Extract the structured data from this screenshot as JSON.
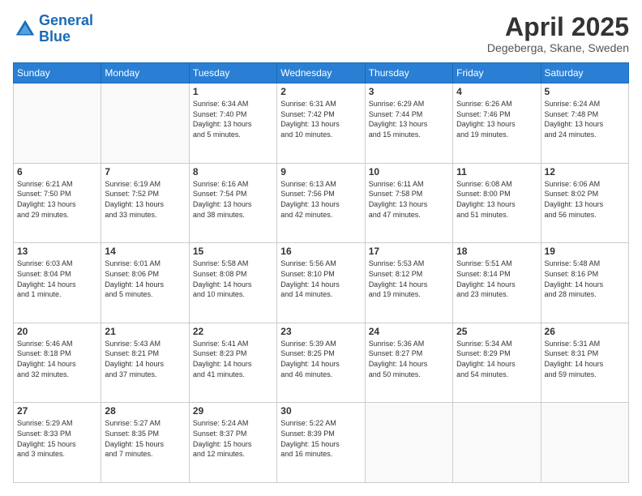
{
  "header": {
    "logo_line1": "General",
    "logo_line2": "Blue",
    "month_title": "April 2025",
    "location": "Degeberga, Skane, Sweden"
  },
  "weekdays": [
    "Sunday",
    "Monday",
    "Tuesday",
    "Wednesday",
    "Thursday",
    "Friday",
    "Saturday"
  ],
  "weeks": [
    [
      {
        "day": "",
        "info": ""
      },
      {
        "day": "",
        "info": ""
      },
      {
        "day": "1",
        "info": "Sunrise: 6:34 AM\nSunset: 7:40 PM\nDaylight: 13 hours\nand 5 minutes."
      },
      {
        "day": "2",
        "info": "Sunrise: 6:31 AM\nSunset: 7:42 PM\nDaylight: 13 hours\nand 10 minutes."
      },
      {
        "day": "3",
        "info": "Sunrise: 6:29 AM\nSunset: 7:44 PM\nDaylight: 13 hours\nand 15 minutes."
      },
      {
        "day": "4",
        "info": "Sunrise: 6:26 AM\nSunset: 7:46 PM\nDaylight: 13 hours\nand 19 minutes."
      },
      {
        "day": "5",
        "info": "Sunrise: 6:24 AM\nSunset: 7:48 PM\nDaylight: 13 hours\nand 24 minutes."
      }
    ],
    [
      {
        "day": "6",
        "info": "Sunrise: 6:21 AM\nSunset: 7:50 PM\nDaylight: 13 hours\nand 29 minutes."
      },
      {
        "day": "7",
        "info": "Sunrise: 6:19 AM\nSunset: 7:52 PM\nDaylight: 13 hours\nand 33 minutes."
      },
      {
        "day": "8",
        "info": "Sunrise: 6:16 AM\nSunset: 7:54 PM\nDaylight: 13 hours\nand 38 minutes."
      },
      {
        "day": "9",
        "info": "Sunrise: 6:13 AM\nSunset: 7:56 PM\nDaylight: 13 hours\nand 42 minutes."
      },
      {
        "day": "10",
        "info": "Sunrise: 6:11 AM\nSunset: 7:58 PM\nDaylight: 13 hours\nand 47 minutes."
      },
      {
        "day": "11",
        "info": "Sunrise: 6:08 AM\nSunset: 8:00 PM\nDaylight: 13 hours\nand 51 minutes."
      },
      {
        "day": "12",
        "info": "Sunrise: 6:06 AM\nSunset: 8:02 PM\nDaylight: 13 hours\nand 56 minutes."
      }
    ],
    [
      {
        "day": "13",
        "info": "Sunrise: 6:03 AM\nSunset: 8:04 PM\nDaylight: 14 hours\nand 1 minute."
      },
      {
        "day": "14",
        "info": "Sunrise: 6:01 AM\nSunset: 8:06 PM\nDaylight: 14 hours\nand 5 minutes."
      },
      {
        "day": "15",
        "info": "Sunrise: 5:58 AM\nSunset: 8:08 PM\nDaylight: 14 hours\nand 10 minutes."
      },
      {
        "day": "16",
        "info": "Sunrise: 5:56 AM\nSunset: 8:10 PM\nDaylight: 14 hours\nand 14 minutes."
      },
      {
        "day": "17",
        "info": "Sunrise: 5:53 AM\nSunset: 8:12 PM\nDaylight: 14 hours\nand 19 minutes."
      },
      {
        "day": "18",
        "info": "Sunrise: 5:51 AM\nSunset: 8:14 PM\nDaylight: 14 hours\nand 23 minutes."
      },
      {
        "day": "19",
        "info": "Sunrise: 5:48 AM\nSunset: 8:16 PM\nDaylight: 14 hours\nand 28 minutes."
      }
    ],
    [
      {
        "day": "20",
        "info": "Sunrise: 5:46 AM\nSunset: 8:18 PM\nDaylight: 14 hours\nand 32 minutes."
      },
      {
        "day": "21",
        "info": "Sunrise: 5:43 AM\nSunset: 8:21 PM\nDaylight: 14 hours\nand 37 minutes."
      },
      {
        "day": "22",
        "info": "Sunrise: 5:41 AM\nSunset: 8:23 PM\nDaylight: 14 hours\nand 41 minutes."
      },
      {
        "day": "23",
        "info": "Sunrise: 5:39 AM\nSunset: 8:25 PM\nDaylight: 14 hours\nand 46 minutes."
      },
      {
        "day": "24",
        "info": "Sunrise: 5:36 AM\nSunset: 8:27 PM\nDaylight: 14 hours\nand 50 minutes."
      },
      {
        "day": "25",
        "info": "Sunrise: 5:34 AM\nSunset: 8:29 PM\nDaylight: 14 hours\nand 54 minutes."
      },
      {
        "day": "26",
        "info": "Sunrise: 5:31 AM\nSunset: 8:31 PM\nDaylight: 14 hours\nand 59 minutes."
      }
    ],
    [
      {
        "day": "27",
        "info": "Sunrise: 5:29 AM\nSunset: 8:33 PM\nDaylight: 15 hours\nand 3 minutes."
      },
      {
        "day": "28",
        "info": "Sunrise: 5:27 AM\nSunset: 8:35 PM\nDaylight: 15 hours\nand 7 minutes."
      },
      {
        "day": "29",
        "info": "Sunrise: 5:24 AM\nSunset: 8:37 PM\nDaylight: 15 hours\nand 12 minutes."
      },
      {
        "day": "30",
        "info": "Sunrise: 5:22 AM\nSunset: 8:39 PM\nDaylight: 15 hours\nand 16 minutes."
      },
      {
        "day": "",
        "info": ""
      },
      {
        "day": "",
        "info": ""
      },
      {
        "day": "",
        "info": ""
      }
    ]
  ]
}
